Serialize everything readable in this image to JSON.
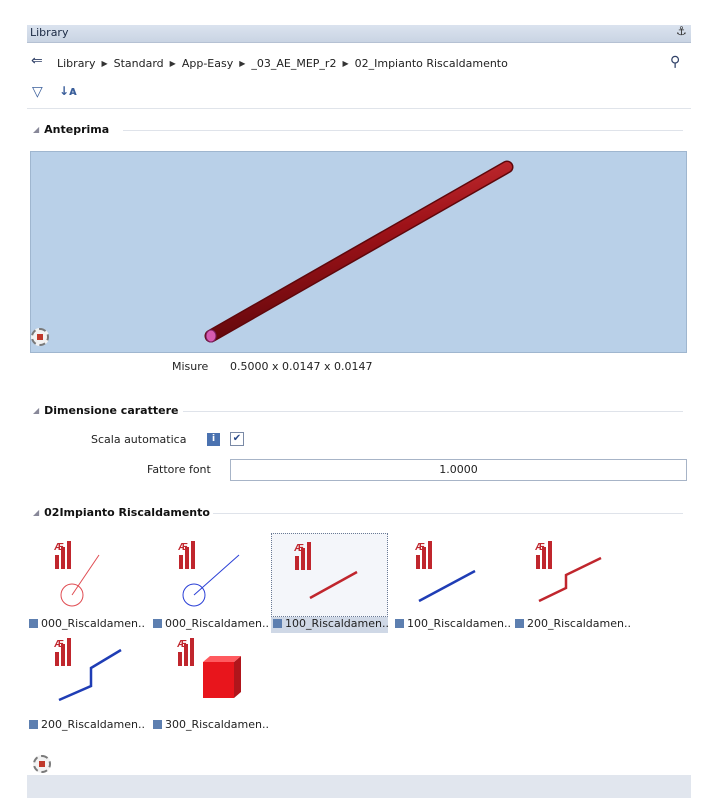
{
  "window": {
    "title": "Library",
    "pin_glyph": "ᵖ",
    "close_glyph": "×"
  },
  "breadcrumb": [
    "Library",
    "Standard",
    "App-Easy",
    "_03_AE_MEP_r2",
    "02_Impianto Riscaldamento"
  ],
  "sections": {
    "preview": {
      "title": "Anteprima",
      "measure_label": "Misure",
      "measure_value": "0.5000 x 0.0147 x 0.0147"
    },
    "font": {
      "title": "Dimensione carattere",
      "auto_scale_label": "Scala automatica",
      "auto_scale_checked": true,
      "font_factor_label": "Fattore font",
      "font_factor_value": "1.0000"
    },
    "library": {
      "title": "02Impianto Riscaldamento"
    }
  },
  "items": [
    {
      "caption": "000_Riscaldamen...",
      "icon": "red-thin-line-with-circle",
      "selected": false
    },
    {
      "caption": "000_Riscaldamen...",
      "icon": "blue-thin-line-with-circle",
      "selected": false
    },
    {
      "caption": "100_Riscaldamen...",
      "icon": "red-diagonal-pipe",
      "selected": true
    },
    {
      "caption": "100_Riscaldamen...",
      "icon": "blue-diagonal-pipe",
      "selected": false
    },
    {
      "caption": "200_Riscaldamen...",
      "icon": "red-stepped-pipe",
      "selected": false
    },
    {
      "caption": "200_Riscaldamen...",
      "icon": "blue-stepped-pipe",
      "selected": false
    },
    {
      "caption": "300_Riscaldamen...",
      "icon": "red-block",
      "selected": false
    }
  ],
  "colors": {
    "accent_red": "#c0262d",
    "accent_blue": "#1f3db5",
    "preview_bg": "#b9d0e8"
  }
}
